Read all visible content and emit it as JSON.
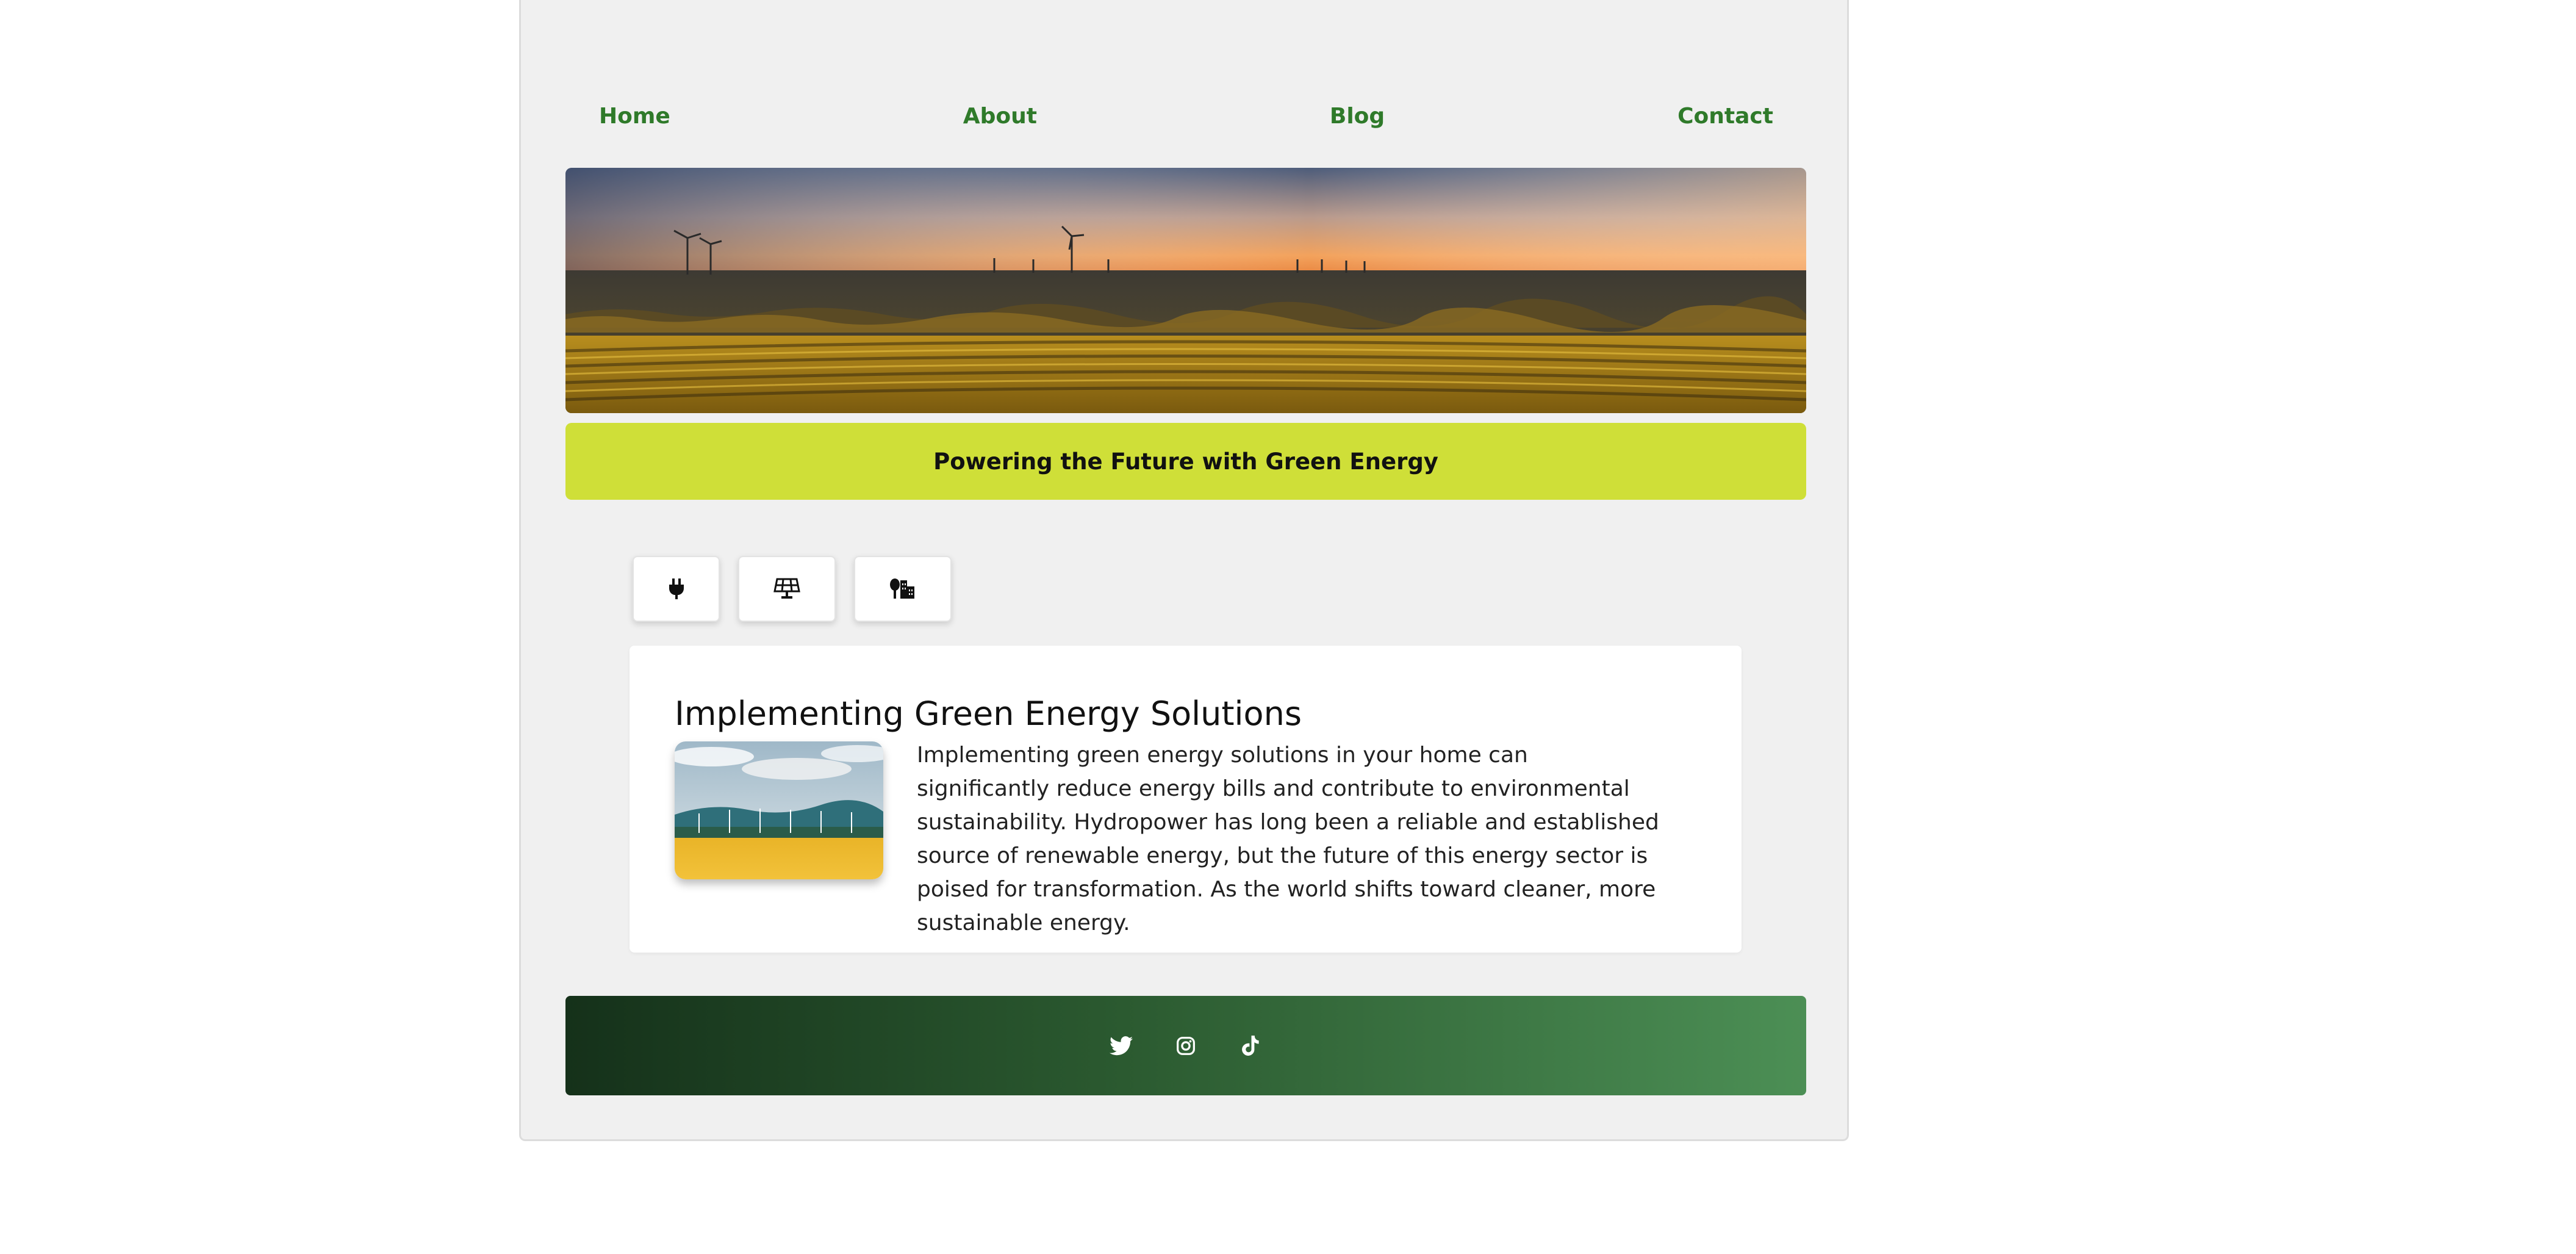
{
  "nav": {
    "items": [
      {
        "label": "Home"
      },
      {
        "label": "About"
      },
      {
        "label": "Blog"
      },
      {
        "label": "Contact"
      }
    ]
  },
  "hero": {
    "image_icon": "wind-farm-sunset-image"
  },
  "tagline": "Powering the Future with Green Energy",
  "icon_buttons": [
    {
      "icon": "plug-icon"
    },
    {
      "icon": "solar-panel-icon"
    },
    {
      "icon": "city-tree-icon"
    }
  ],
  "article": {
    "title": "Implementing Green Energy Solutions",
    "image_icon": "wind-turbines-field-image",
    "body": "Implementing green energy solutions in your home can significantly reduce energy bills and contribute to environmental sustainability. Hydropower has long been a reliable and established source of renewable energy, but the future of this energy sector is poised for transformation. As the world shifts toward cleaner, more sustainable energy."
  },
  "footer": {
    "social": [
      {
        "icon": "twitter-icon"
      },
      {
        "icon": "instagram-icon"
      },
      {
        "icon": "tiktok-icon"
      }
    ]
  },
  "colors": {
    "nav_link": "#2f7a2a",
    "tagline_bg": "#cfdf38",
    "footer_start": "#15311a",
    "footer_end": "#4c8f55"
  }
}
